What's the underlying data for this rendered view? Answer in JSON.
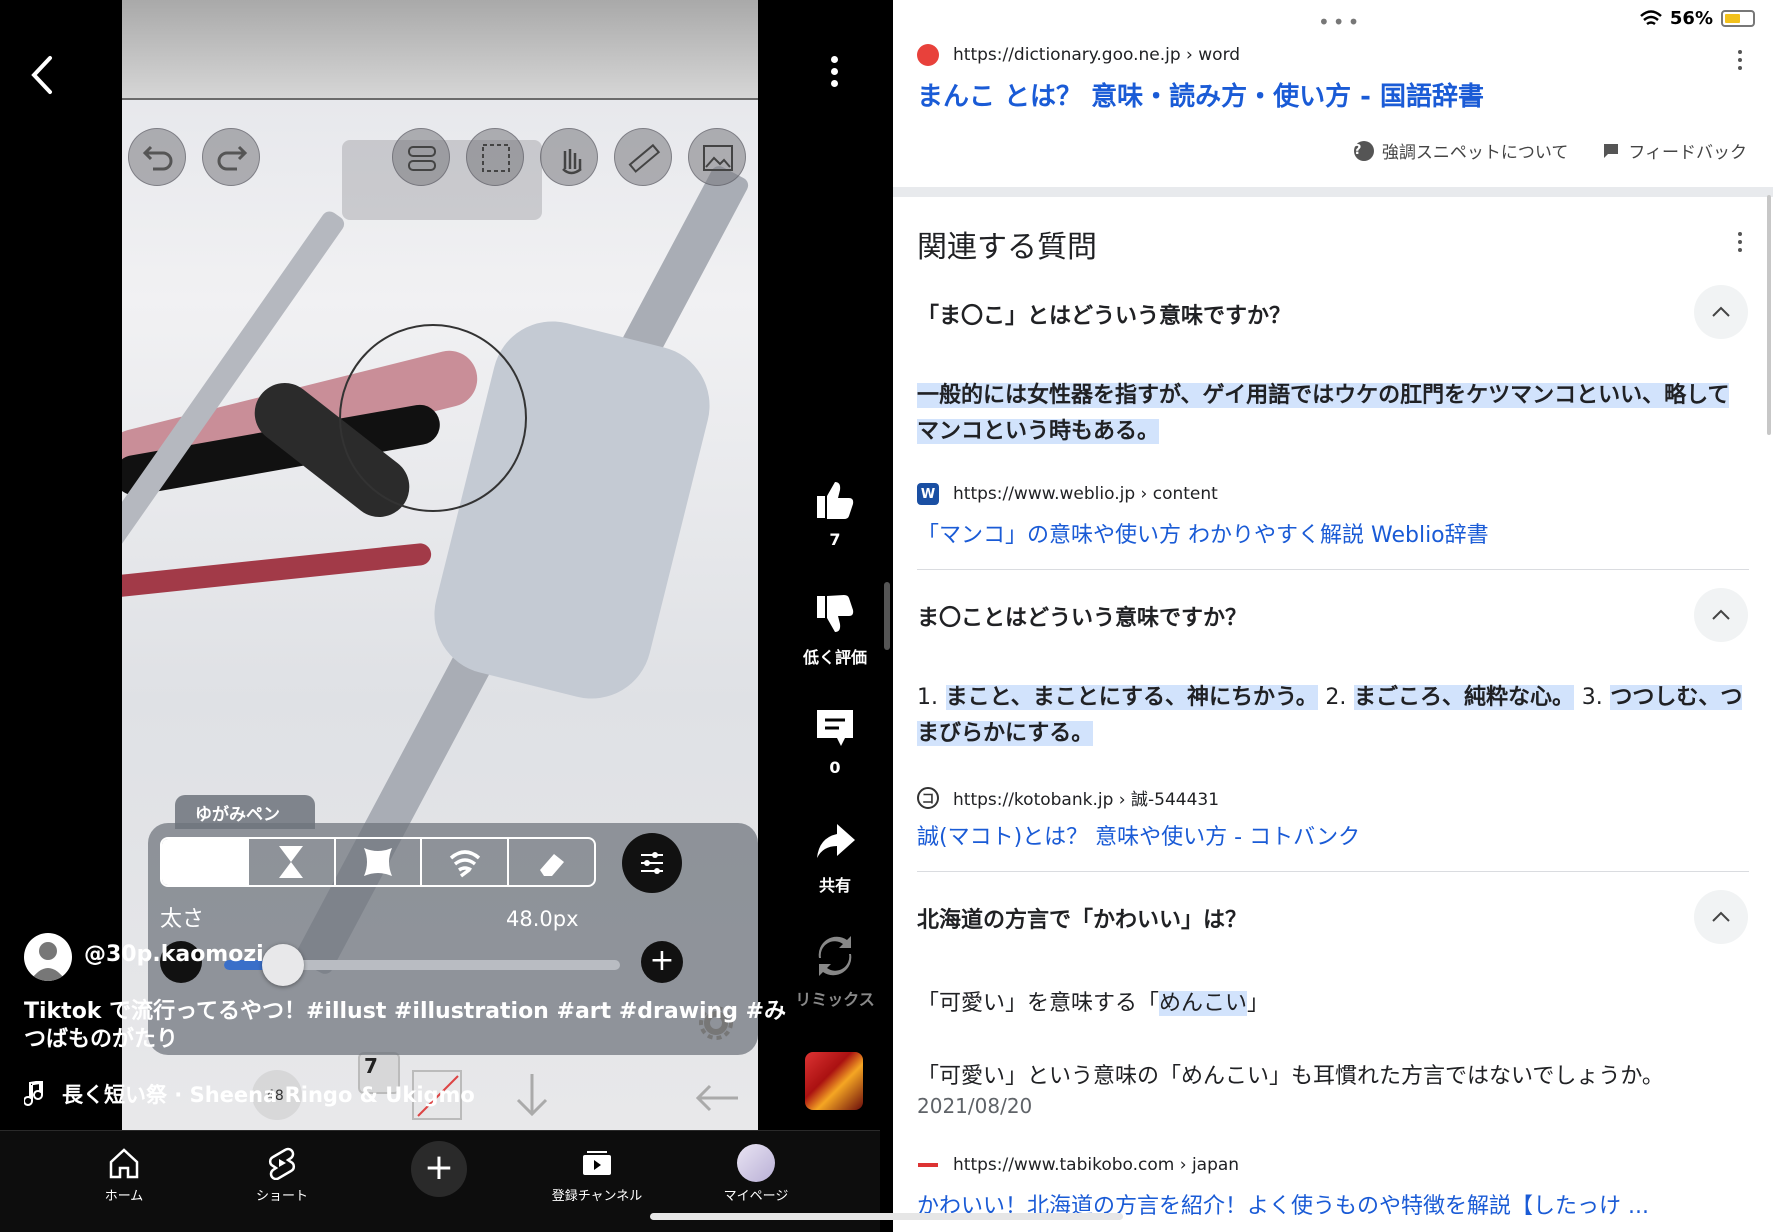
{
  "left_app": {
    "top_dots": "•••",
    "editor": {
      "pen_tab_label": "ゆがみペン",
      "thickness_label": "太さ",
      "thickness_value": "48.0px",
      "slider_value_fraction": 0.15,
      "brush_size_value": "48",
      "layer_count": "7"
    },
    "actions": {
      "like_count": "7",
      "dislike_label": "低く評価",
      "comment_count": "0",
      "share_label": "共有",
      "remix_label": "リミックス"
    },
    "channel_name": "@30p.kaomozi",
    "caption": "Tiktok で流行ってるやつ！#illust #illustration #art #drawing #みつばものがたり",
    "music": "長く短い祭 · Sheena Ringo & Ukigmo",
    "nav": {
      "home": "ホーム",
      "shorts": "ショート",
      "subscriptions": "登録チャンネル",
      "mypage": "マイページ"
    }
  },
  "right_app": {
    "top_dots": "•••",
    "status": {
      "battery": "56%",
      "battery_fraction": 0.56
    },
    "featured": {
      "source_url": "https://dictionary.goo.ne.jp › word",
      "title": "まんこ とは？ 意味・読み方・使い方 - 国語辞書",
      "about_snippets": "強調スニペットについて",
      "feedback": "フィードバック"
    },
    "related_title": "関連する質問",
    "questions": [
      {
        "question": "「ま〇こ」とはどういう意味ですか？",
        "answer": "一般的には女性器を指すが、ゲイ用語ではウケの肛門をケツマンコといい、略してマンコという時もある。",
        "source_url": "https://www.weblio.jp › content",
        "source_icon": "W",
        "link": "「マンコ」の意味や使い方 わかりやすく解説 Weblio辞書"
      },
      {
        "question": "ま〇ことはどういう意味ですか？",
        "answer_parts": [
          "1.",
          "まこと、まことにする、神にちかう。",
          "2.",
          "まごころ、純粋な心。",
          "3.",
          "つつしむ、つまびらかにする。"
        ],
        "source_url": "https://kotobank.jp › 誠-544431",
        "source_icon": "コ",
        "link": "誠(マコト)とは？ 意味や使い方 - コトバンク"
      },
      {
        "question": "北海道の方言で「かわいい」は？",
        "line1_a": "「可愛い」を意味する「",
        "line1_b": "めんこい",
        "line1_c": "」",
        "line2": "「可愛い」という意味の「めんこい」も耳慣れた方言ではないでしょうか。",
        "date": "2021/08/20",
        "source_url": "https://www.tabikobo.com › japan",
        "link": "かわいい！北海道の方言を紹介！よく使うものや特徴を解説【したっけ ..."
      }
    ]
  },
  "colors": {
    "link_blue": "#1a5bd6",
    "highlight": "#d2e3fc",
    "accent_slider": "#3a6fc9"
  }
}
